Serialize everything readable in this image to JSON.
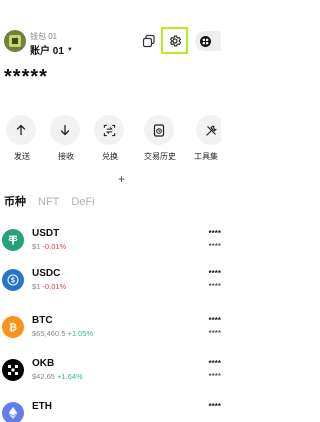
{
  "header": {
    "wallet_name": "钱包 01",
    "account_name": "账户 01",
    "balance": "*****"
  },
  "actions": [
    {
      "label": "发送",
      "icon": "arrow-up-icon"
    },
    {
      "label": "接收",
      "icon": "arrow-down-icon"
    },
    {
      "label": "兑换",
      "icon": "swap-icon"
    },
    {
      "label": "交易历史",
      "icon": "history-icon"
    },
    {
      "label": "工具集",
      "icon": "tools-icon"
    }
  ],
  "add_label": "+",
  "tabs": [
    "币种",
    "NFT",
    "DeFi"
  ],
  "assets": [
    {
      "symbol": "USDT",
      "price": "$1",
      "change": "-0.01%",
      "amount": "****",
      "value": "****",
      "color": "#26a17b"
    },
    {
      "symbol": "USDC",
      "price": "$1",
      "change": "-0.01%",
      "amount": "****",
      "value": "****",
      "color": "#2775ca"
    },
    {
      "symbol": "BTC",
      "price": "$65,460.5",
      "change": "+1.05%",
      "amount": "****",
      "value": "****",
      "color": "#f7931a"
    },
    {
      "symbol": "OKB",
      "price": "$42.65",
      "change": "+1.64%",
      "amount": "****",
      "value": "****",
      "color": "#000000"
    },
    {
      "symbol": "ETH",
      "price": "",
      "change": "",
      "amount": "****",
      "value": "****",
      "color": "#627eea"
    }
  ],
  "colors": {
    "highlight_border": "#b7ef1a",
    "negative": "#e0434a",
    "positive": "#2dbd85"
  }
}
